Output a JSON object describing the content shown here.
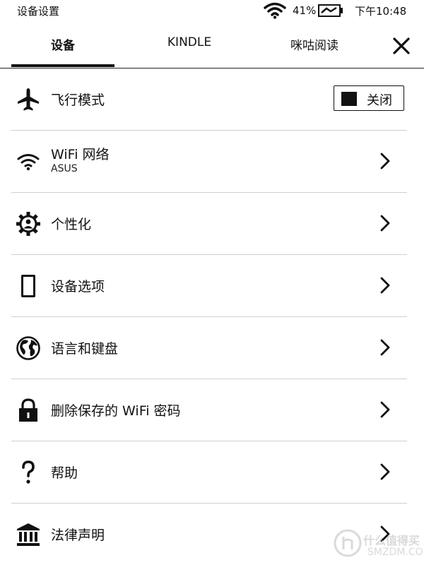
{
  "status": {
    "title": "设备设置",
    "battery": "41%",
    "time": "下午10:48"
  },
  "tabs": [
    {
      "label": "设备",
      "active": true
    },
    {
      "label": "KINDLE",
      "active": false
    },
    {
      "label": "咪咕阅读",
      "active": false
    }
  ],
  "rows": [
    {
      "label": "飞行模式",
      "icon": "airplane-icon",
      "toggle_label": "关闭"
    },
    {
      "label": "WiFi 网络",
      "sub": "ASUS",
      "icon": "wifi-icon"
    },
    {
      "label": "个性化",
      "icon": "gear-person-icon"
    },
    {
      "label": "设备选项",
      "icon": "device-icon"
    },
    {
      "label": "语言和键盘",
      "icon": "globe-icon"
    },
    {
      "label": "删除保存的 WiFi 密码",
      "icon": "lock-icon"
    },
    {
      "label": "帮助",
      "icon": "help-icon"
    },
    {
      "label": "法律声明",
      "icon": "bank-icon"
    }
  ],
  "watermark": {
    "text": "什么值得买",
    "sub": "SMZDM.COM"
  },
  "colors": {
    "ink": "#111111",
    "divider": "#cfcfcf",
    "background": "#ffffff"
  }
}
